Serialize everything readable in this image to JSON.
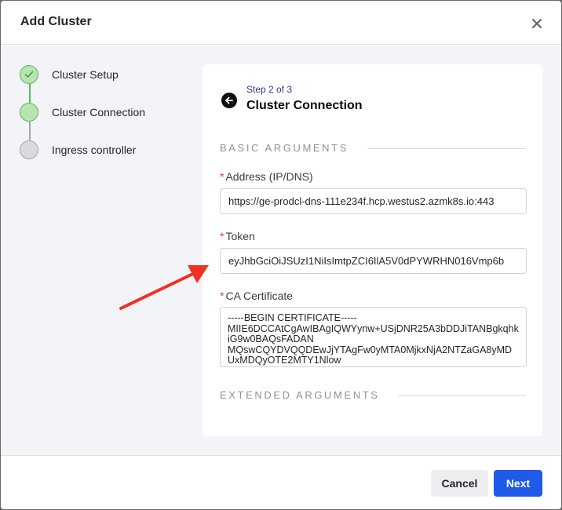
{
  "modal": {
    "title": "Add Cluster",
    "close_icon": "close-icon"
  },
  "stepper": {
    "steps": [
      {
        "label": "Cluster Setup",
        "status": "complete"
      },
      {
        "label": "Cluster Connection",
        "status": "current"
      },
      {
        "label": "Ingress controller",
        "status": "pending"
      }
    ],
    "complete_color": "#b7e4b1",
    "pending_color": "#d9dadd"
  },
  "card": {
    "step_indicator": "Step 2 of 3",
    "title": "Cluster Connection",
    "back_icon": "arrow-left-icon",
    "sections": {
      "basic": "BASIC ARGUMENTS",
      "extended": "EXTENDED ARGUMENTS"
    },
    "fields": {
      "address": {
        "label": "Address (IP/DNS)",
        "value": "https://ge-prodcl-dns-111e234f.hcp.westus2.azmk8s.io:443",
        "required": true
      },
      "token": {
        "label": "Token",
        "value": "eyJhbGciOiJSUzI1NiIsImtpZCI6IlA5V0dPYWRHN016Vmp6b",
        "required": true
      },
      "ca_certificate": {
        "label": "CA Certificate",
        "value": "-----BEGIN CERTIFICATE-----\nMIIE6DCCAtCgAwIBAgIQWYynw+USjDNR25A3bDDJiTANBgkqhkiG9w0BAQsFADAN\nMQswCQYDVQQDEwJjYTAgFw0yMTA0MjkxNjA2NTZaGA8yMDUxMDQyOTE2MTY1Nlow",
        "required": true
      }
    }
  },
  "footer": {
    "cancel_label": "Cancel",
    "next_label": "Next"
  },
  "annotation": {
    "arrow_color": "#ee3124"
  }
}
